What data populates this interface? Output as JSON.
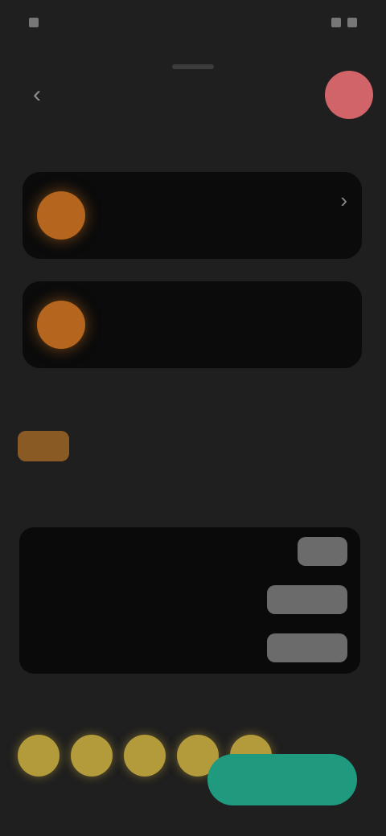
{
  "status_bar": {
    "time": "",
    "indicators": ""
  },
  "header": {
    "back_icon": "chevron-left-icon",
    "title": ""
  },
  "cards": [
    {
      "title": "",
      "subtitle": "",
      "more_icon": "chevron-right-icon"
    },
    {
      "title": "",
      "subtitle": ""
    }
  ],
  "sections": {
    "first": "",
    "second": "",
    "third": ""
  },
  "chip": {
    "label": ""
  },
  "settings": [
    {
      "label": "",
      "value": ""
    },
    {
      "label": "",
      "value": ""
    },
    {
      "label": "",
      "value": ""
    }
  ],
  "rating": {
    "filled": 5,
    "total": 5
  },
  "actions": {
    "primary_label": ""
  },
  "colors": {
    "background": "#1f1f1f",
    "card": "#0b0b0b",
    "accent_orange": "#b5651d",
    "avatar": "#d06468",
    "primary": "#1f9a7f",
    "star": "#b39a3a"
  }
}
